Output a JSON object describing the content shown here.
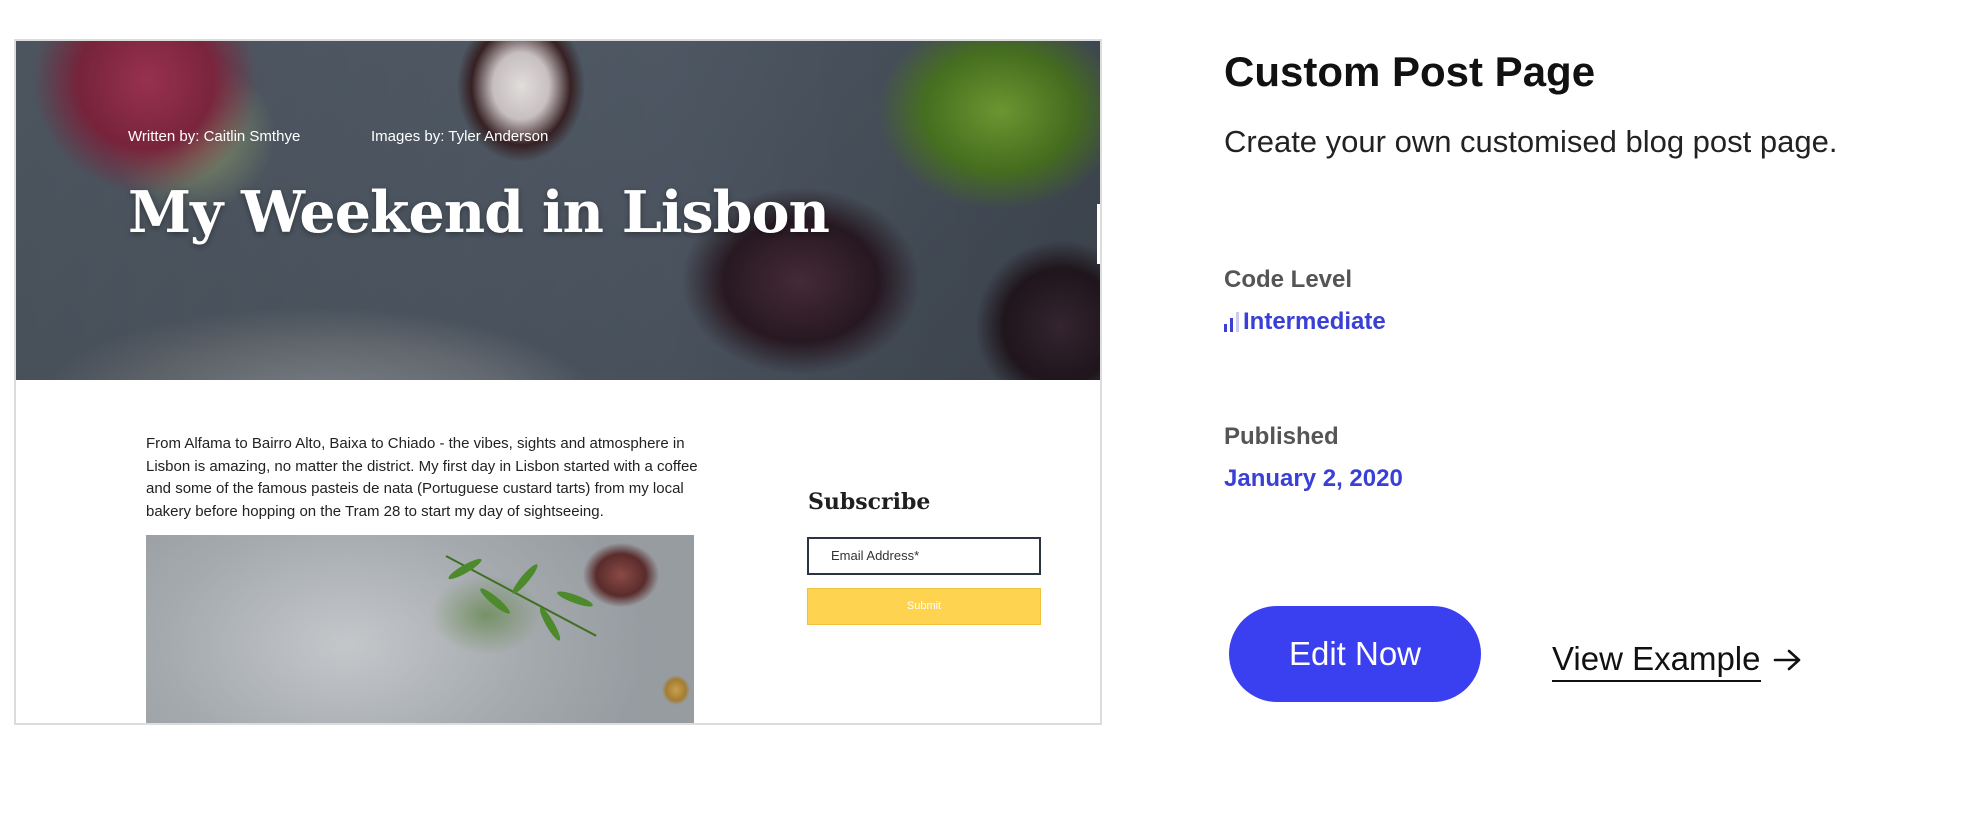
{
  "preview": {
    "hero": {
      "written_by": "Written by: Caitlin Smthye",
      "images_by": "Images by: Tyler Anderson",
      "title": "My Weekend in Lisbon"
    },
    "article": {
      "text": "From Alfama to Bairro Alto, Baixa to Chiado - the vibes, sights and atmosphere in Lisbon is amazing, no matter the district. My first day in Lisbon started with a coffee and some of the famous pasteis de nata (Portuguese custard tarts) from my local bakery before hopping on the Tram 28 to start my day of sightseeing."
    },
    "subscribe": {
      "title": "Subscribe",
      "email_placeholder": "Email Address*",
      "submit_label": "Submit",
      "submit_color": "#fdd34f"
    }
  },
  "info": {
    "title": "Custom Post Page",
    "description": "Create your own customised blog post page.",
    "code_level_label": "Code Level",
    "code_level_value": "Intermediate",
    "code_level_icon": "signal-bars-icon",
    "published_label": "Published",
    "published_value": "January 2, 2020",
    "accent_color": "#3a3fd6"
  },
  "actions": {
    "edit_label": "Edit Now",
    "edit_color": "#3a3ff0",
    "view_label": "View Example",
    "view_icon": "arrow-right-icon"
  }
}
